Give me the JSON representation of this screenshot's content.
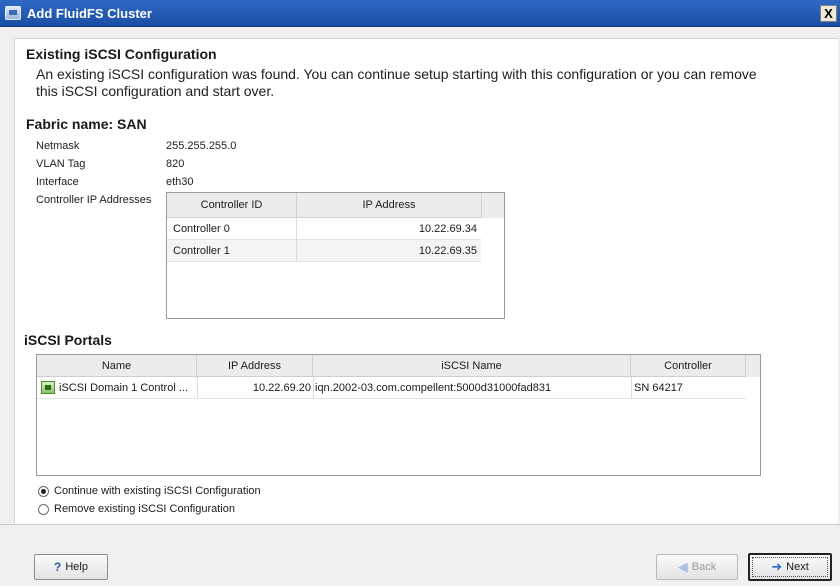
{
  "window": {
    "title": "Add FluidFS Cluster",
    "close_glyph": "X"
  },
  "existing": {
    "heading": "Existing iSCSI Configuration",
    "description": "An existing iSCSI configuration was found.  You can continue setup starting with this configuration or you can remove this iSCSI configuration and start over."
  },
  "fabric": {
    "heading": "Fabric name: SAN",
    "properties": [
      {
        "label": "Netmask",
        "value": "255.255.255.0"
      },
      {
        "label": "VLAN Tag",
        "value": "820"
      },
      {
        "label": "Interface",
        "value": "eth30"
      }
    ],
    "controller_ip_label": "Controller IP Addresses",
    "controller_table": {
      "columns": [
        "Controller ID",
        "IP Address"
      ],
      "rows": [
        {
          "id": "Controller 0",
          "ip": "10.22.69.34"
        },
        {
          "id": "Controller 1",
          "ip": "10.22.69.35"
        }
      ]
    }
  },
  "portals": {
    "heading": "iSCSI Portals",
    "columns": [
      "Name",
      "IP Address",
      "iSCSI Name",
      "Controller"
    ],
    "rows": [
      {
        "name": "iSCSI Domain 1 Control ...",
        "ip": "10.22.69.20",
        "iscsi_name": "iqn.2002-03.com.compellent:5000d31000fad831",
        "controller": "SN 64217",
        "icon": "portal-icon"
      }
    ]
  },
  "options": {
    "continue_label": "Continue with existing iSCSI Configuration",
    "remove_label": "Remove existing iSCSI Configuration",
    "selected": "continue"
  },
  "buttons": {
    "help_label": "Help",
    "help_icon": "?",
    "back_label": "Back",
    "next_label": "Next"
  },
  "colors": {
    "titlebar": "#1b4fa4",
    "content_bg": "#ffffff",
    "dialog_bg": "#f0f0f0"
  }
}
